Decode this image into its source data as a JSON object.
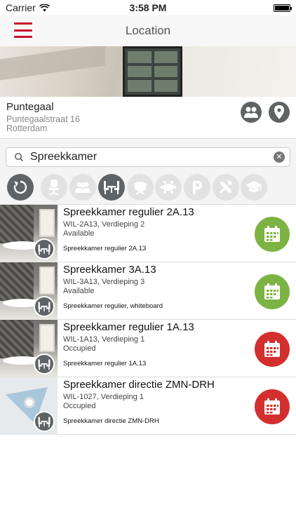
{
  "status_bar": {
    "carrier": "Carrier",
    "time": "3:58 PM",
    "battery_level": 1.0
  },
  "nav": {
    "title": "Location",
    "menu_icon": "hamburger-menu-icon",
    "accent_color": "#c8102e"
  },
  "hero": {
    "image": "building-interior-photo"
  },
  "location": {
    "name": "Puntegaal",
    "street": "Puntegaalstraat 16",
    "city": "Rotterdam",
    "actions": [
      {
        "icon": "people-icon"
      },
      {
        "icon": "map-pin-icon"
      }
    ]
  },
  "search": {
    "value": "Spreekkamer",
    "clear_icon": "clear-icon"
  },
  "filters": [
    {
      "icon": "refresh-icon",
      "active": true
    },
    {
      "icon": "office-chair-icon",
      "active": false
    },
    {
      "icon": "people-icon",
      "active": false
    },
    {
      "icon": "meeting-table-icon",
      "active": true
    },
    {
      "icon": "lounge-chair-icon",
      "active": false
    },
    {
      "icon": "conference-table-icon",
      "active": false
    },
    {
      "icon": "parking-icon",
      "active": false
    },
    {
      "icon": "tools-icon",
      "active": false
    },
    {
      "icon": "graduation-cap-icon",
      "active": false
    }
  ],
  "status_colors": {
    "Available": "#7cb342",
    "Occupied": "#d32f2f"
  },
  "rooms": [
    {
      "name": "Spreekkamer regulier 2A.13",
      "code": "WIL-2A13, Verdieping 2",
      "status": "Available",
      "description": "Spreekkamer regulier 2A.13",
      "thumb": "photo"
    },
    {
      "name": "Spreekkamer 3A.13",
      "code": "WIL-3A13, Verdieping 3",
      "status": "Available",
      "description": "Spreekkamer regulier, whiteboard",
      "thumb": "photo"
    },
    {
      "name": "Spreekkamer regulier 1A.13",
      "code": "WIL-1A13, Verdieping 1",
      "status": "Occupied",
      "description": "Spreekkamer regulier 1A.13",
      "thumb": "photo"
    },
    {
      "name": "Spreekkamer directie ZMN-DRH",
      "code": "WIL-1027, Verdieping 1",
      "status": "Occupied",
      "description": "Spreekkamer directie ZMN-DRH",
      "thumb": "drawing"
    }
  ]
}
